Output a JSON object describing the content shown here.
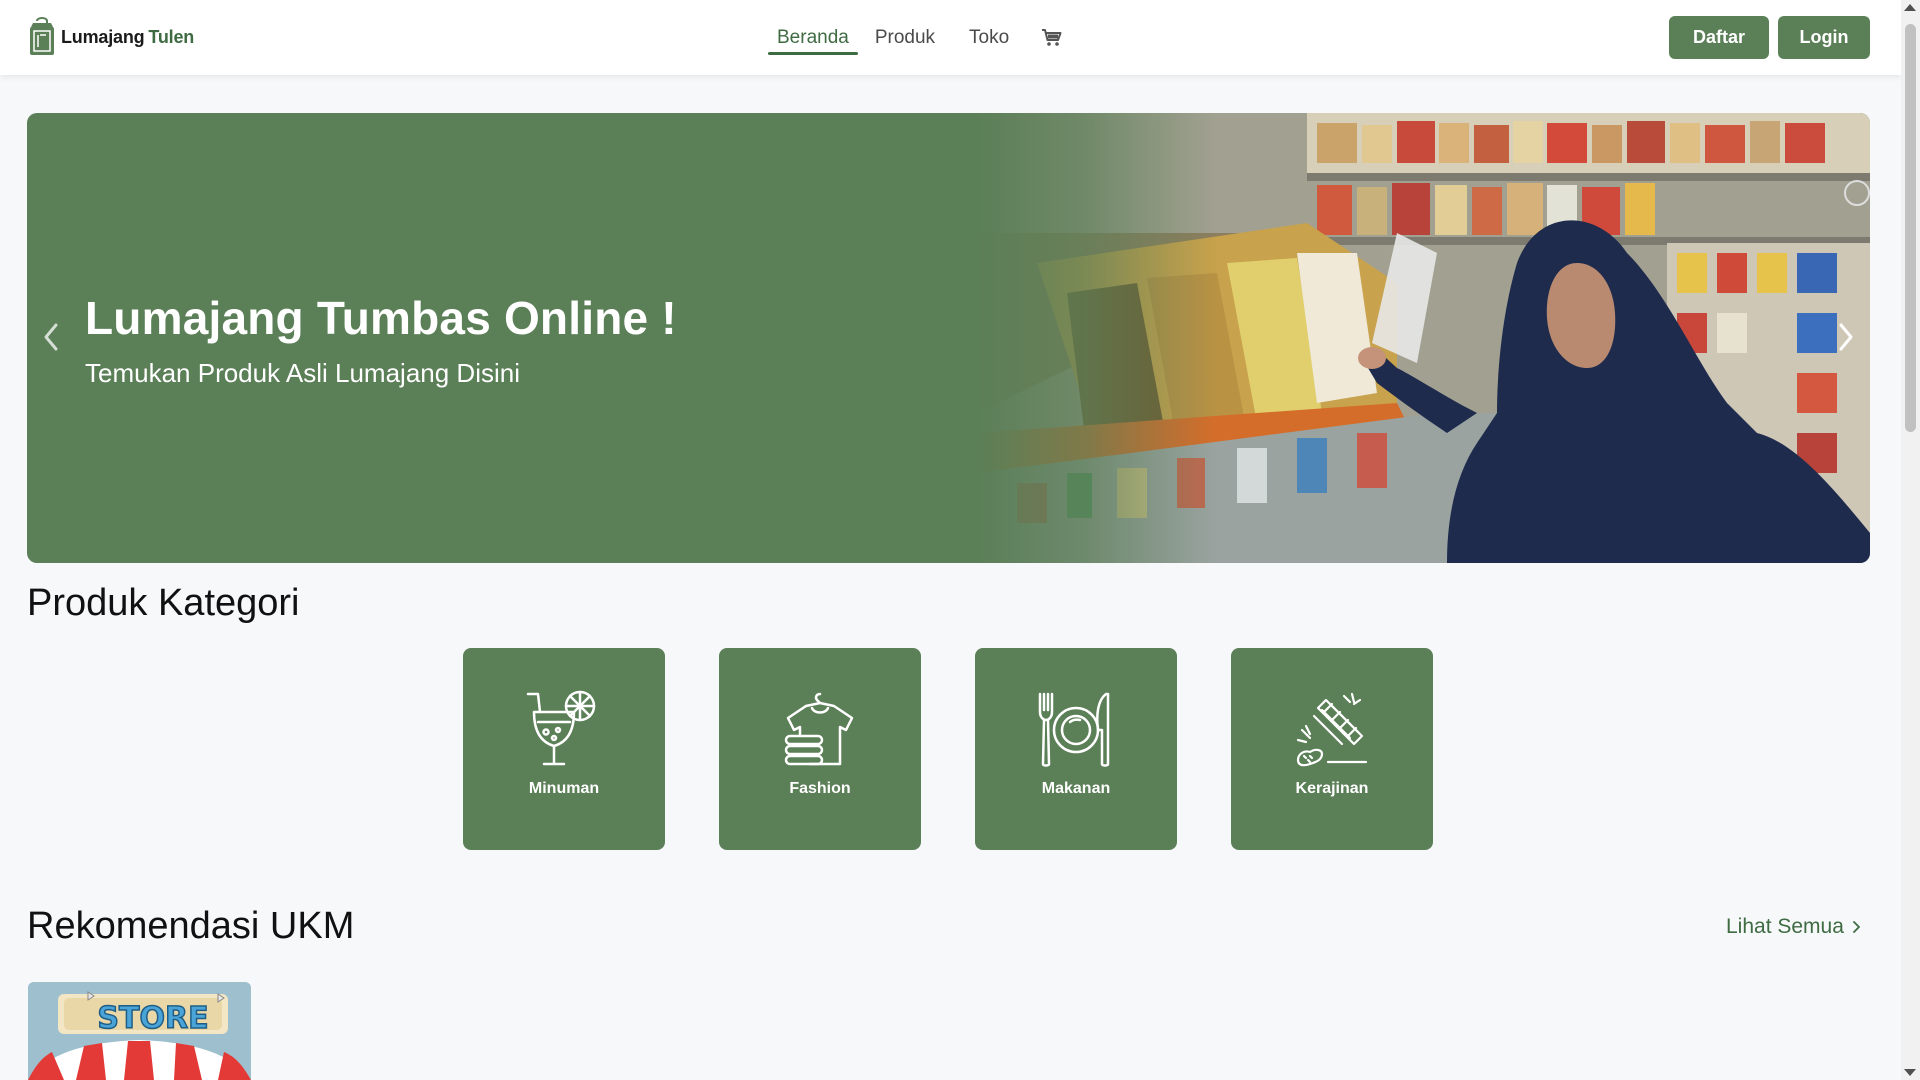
{
  "brand": {
    "name_part1": "Lumajang",
    "name_part2": "Tulen",
    "icon": "shopping-bag-icon"
  },
  "nav": {
    "links": [
      {
        "label": "Beranda",
        "active": true
      },
      {
        "label": "Produk",
        "active": false
      },
      {
        "label": "Toko",
        "active": false
      }
    ],
    "cart_icon": "cart-icon"
  },
  "auth": {
    "register_label": "Daftar",
    "login_label": "Login"
  },
  "hero": {
    "title": "Lumajang Tumbas Online !",
    "subtitle": "Temukan Produk Asli Lumajang Disini",
    "prev_icon": "chevron-left-icon",
    "next_icon": "chevron-right-icon"
  },
  "categories": {
    "title": "Produk Kategori",
    "items": [
      {
        "label": "Minuman",
        "icon": "drink-icon"
      },
      {
        "label": "Fashion",
        "icon": "clothes-icon"
      },
      {
        "label": "Makanan",
        "icon": "plate-icon"
      },
      {
        "label": "Kerajinan",
        "icon": "craft-icon"
      }
    ]
  },
  "recommendations": {
    "title": "Rekomendasi UKM",
    "see_all_label": "Lihat Semua",
    "items": [
      {
        "image_text": "STORE"
      }
    ]
  },
  "colors": {
    "primary": "#5b7f57",
    "primary_text": "#3f6b43",
    "background": "#f6f8fa"
  }
}
